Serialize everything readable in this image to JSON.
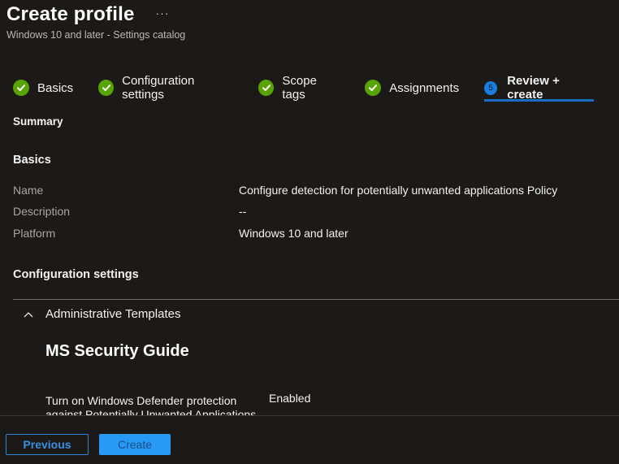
{
  "header": {
    "title": "Create profile",
    "more_label": "···",
    "subtitle": "Windows 10 and later - Settings catalog"
  },
  "steps": [
    {
      "label": "Basics",
      "status": "complete",
      "icon": "check-circle-icon"
    },
    {
      "label": "Configuration settings",
      "status": "complete",
      "icon": "check-circle-icon"
    },
    {
      "label": "Scope tags",
      "status": "complete",
      "icon": "check-circle-icon"
    },
    {
      "label": "Assignments",
      "status": "complete",
      "icon": "check-circle-icon"
    },
    {
      "label": "Review + create",
      "status": "active",
      "number": "5"
    }
  ],
  "summary": {
    "label": "Summary",
    "basics": {
      "heading": "Basics",
      "rows": [
        {
          "key": "Name",
          "value": "Configure detection for potentially unwanted applications Policy"
        },
        {
          "key": "Description",
          "value": "--"
        },
        {
          "key": "Platform",
          "value": "Windows 10 and later"
        }
      ]
    },
    "configuration": {
      "heading": "Configuration settings",
      "accordion": {
        "label": "Administrative Templates",
        "expanded": true,
        "icon": "chevron-up-icon"
      },
      "category": "MS Security Guide",
      "settings": [
        {
          "name": "Turn on Windows Defender protection against Potentially Unwanted Applications",
          "value": "Enabled"
        }
      ]
    }
  },
  "footer": {
    "previous_label": "Previous",
    "create_label": "Create"
  },
  "colors": {
    "background": "#1b1a19",
    "success": "#57a300",
    "accent": "#1a7cdb",
    "primary_button": "#2899f5"
  }
}
